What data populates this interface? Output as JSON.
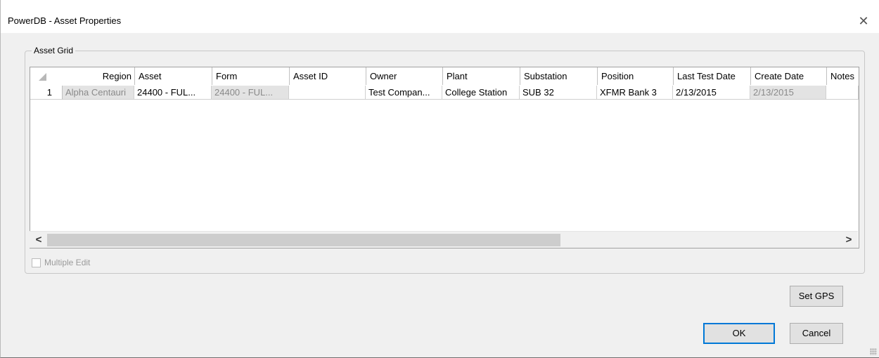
{
  "window": {
    "title": "PowerDB - Asset Properties",
    "close_label": "✕"
  },
  "group": {
    "label": "Asset Grid"
  },
  "grid": {
    "columns": [
      "Region",
      "Asset",
      "Form",
      "Asset ID",
      "Owner",
      "Plant",
      "Substation",
      "Position",
      "Last Test Date",
      "Create Date",
      "Notes"
    ],
    "rows": [
      {
        "row_number": "1",
        "cells": [
          "Alpha Centauri",
          "24400 - FUL...",
          "24400 - FUL...",
          "",
          "Test Compan...",
          "College Station",
          "SUB 32",
          "XFMR Bank 3",
          "2/13/2015",
          "2/13/2015",
          ""
        ]
      }
    ]
  },
  "scrollbar": {
    "left_arrow": "<",
    "right_arrow": ">"
  },
  "multiple_edit": {
    "label": "Multiple Edit",
    "checked": false,
    "enabled": false
  },
  "buttons": {
    "set_gps": "Set GPS",
    "ok": "OK",
    "cancel": "Cancel"
  }
}
